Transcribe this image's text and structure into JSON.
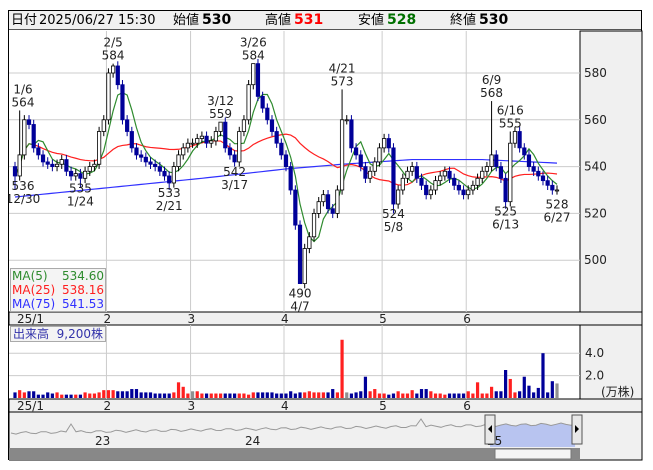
{
  "header": {
    "date_label": "日付",
    "datetime": "2025/06/27 15:30",
    "open_label": "始値",
    "open": "530",
    "high_label": "高値",
    "high": "531",
    "low_label": "安値",
    "low": "528",
    "close_label": "終値",
    "close": "530"
  },
  "colors": {
    "up_volume": "#ff2020",
    "down_volume": "#000099",
    "flat_volume": "#909090",
    "ma5": "#2e8b2e",
    "ma25": "#ff2020",
    "ma75": "#3030ff",
    "high": "#ff0000",
    "low": "#007000"
  },
  "legend": {
    "ma5_label": "MA(5)",
    "ma5": "534.60",
    "ma25_label": "MA(25)",
    "ma25": "538.16",
    "ma75_label": "MA(75)",
    "ma75": "541.53"
  },
  "volume_panel": {
    "label": "出来高",
    "value": "9,200株",
    "unit": "(万株)"
  },
  "navigator": {
    "labels": [
      "23",
      "24",
      "25"
    ]
  },
  "chart_data": {
    "type": "candlestick",
    "y_ticks": [
      580,
      560,
      540,
      520,
      500
    ],
    "ylim": [
      482,
      592
    ],
    "volume_ticks": [
      "4.0",
      "2.0"
    ],
    "volume_ylim": [
      0,
      6
    ],
    "month_labels": [
      {
        "label": "25/1",
        "index": 0
      },
      {
        "label": "2",
        "index": 20
      },
      {
        "label": "3",
        "index": 38
      },
      {
        "label": "4",
        "index": 58
      },
      {
        "label": "5",
        "index": 79
      },
      {
        "label": "6",
        "index": 97
      }
    ],
    "closes": [
      536,
      545,
      560,
      558,
      548,
      545,
      542,
      541,
      540,
      541,
      543,
      538,
      536,
      537,
      535,
      538,
      540,
      541,
      555,
      560,
      580,
      583,
      575,
      560,
      555,
      548,
      545,
      544,
      542,
      541,
      540,
      538,
      536,
      533,
      540,
      545,
      548,
      550,
      550,
      552,
      553,
      550,
      551,
      555,
      559,
      548,
      545,
      542,
      555,
      560,
      575,
      584,
      570,
      565,
      560,
      555,
      550,
      545,
      540,
      530,
      515,
      490,
      505,
      510,
      520,
      525,
      528,
      522,
      520,
      530,
      560,
      560,
      548,
      545,
      540,
      535,
      538,
      542,
      548,
      552,
      548,
      524,
      530,
      535,
      538,
      540,
      535,
      532,
      528,
      530,
      534,
      536,
      538,
      535,
      532,
      530,
      528,
      530,
      532,
      535,
      538,
      540,
      545,
      540,
      535,
      525,
      550,
      555,
      548,
      545,
      540,
      538,
      536,
      534,
      532,
      530,
      530
    ],
    "highs_override": {
      "1": 564,
      "21": 584,
      "51": 584,
      "44": 559,
      "70": 573,
      "102": 568,
      "106": 555
    },
    "lows_override": {
      "0": 530,
      "14": 531,
      "33": 530,
      "48": 540,
      "61": 490,
      "81": 520,
      "105": 522,
      "116": 528
    },
    "volumes": [
      0.5,
      0.7,
      0.5,
      0.6,
      0.6,
      0.3,
      0.3,
      0.5,
      0.4,
      0.5,
      0.3,
      0.3,
      0.3,
      0.3,
      0.3,
      0.5,
      0.4,
      0.4,
      0.5,
      0.7,
      0.7,
      0.7,
      0.6,
      0.6,
      0.6,
      0.8,
      0.8,
      0.5,
      0.5,
      0.5,
      0.4,
      0.4,
      0.4,
      0.4,
      0.5,
      1.4,
      1.0,
      0.4,
      0.6,
      0.6,
      0.4,
      0.4,
      0.4,
      0.4,
      0.4,
      0.4,
      0.4,
      0.4,
      0.4,
      0.4,
      0.3,
      0.5,
      0.5,
      0.5,
      0.5,
      0.5,
      0.4,
      0.4,
      0.4,
      0.6,
      0.4,
      0.5,
      0.5,
      0.6,
      0.5,
      0.5,
      0.5,
      0.5,
      0.8,
      0.5,
      5.2,
      0.5,
      0.4,
      0.5,
      0.6,
      1.9,
      0.6,
      0.8,
      0.4,
      0.4,
      0.3,
      0.4,
      0.6,
      0.4,
      0.4,
      0.7,
      0.4,
      0.8,
      0.8,
      0.6,
      0.4,
      0.4,
      0.3,
      0.4,
      0.4,
      0.4,
      0.4,
      0.6,
      0.4,
      1.4,
      0.4,
      0.4,
      1.0,
      0.6,
      0.6,
      2.5,
      1.7,
      0.5,
      0.6,
      1.9,
      1.1,
      0.5,
      0.9,
      4.0,
      0.5,
      1.5,
      1.3
    ],
    "ma75_points": [
      [
        0,
        527
      ],
      [
        20,
        531
      ],
      [
        40,
        535
      ],
      [
        58,
        539
      ],
      [
        70,
        541
      ],
      [
        85,
        543
      ],
      [
        100,
        543
      ],
      [
        116,
        541.5
      ]
    ],
    "annotations": [
      {
        "index": 0,
        "date": "12/30",
        "value": "536",
        "pos": "below"
      },
      {
        "index": 1,
        "date": "1/6",
        "value": "564",
        "pos": "above"
      },
      {
        "index": 14,
        "date": "1/24",
        "value": "535",
        "pos": "below"
      },
      {
        "index": 21,
        "date": "2/5",
        "value": "584",
        "pos": "above"
      },
      {
        "index": 33,
        "date": "2/21",
        "value": "533",
        "pos": "below"
      },
      {
        "index": 44,
        "date": "3/12",
        "value": "559",
        "pos": "above"
      },
      {
        "index": 47,
        "date": "3/17",
        "value": "542",
        "pos": "below"
      },
      {
        "index": 51,
        "date": "3/26",
        "value": "584",
        "pos": "above"
      },
      {
        "index": 61,
        "date": "4/7",
        "value": "490",
        "pos": "below"
      },
      {
        "index": 70,
        "date": "4/21",
        "value": "573",
        "pos": "above"
      },
      {
        "index": 81,
        "date": "5/8",
        "value": "524",
        "pos": "below"
      },
      {
        "index": 102,
        "date": "6/9",
        "value": "568",
        "pos": "above"
      },
      {
        "index": 105,
        "date": "6/13",
        "value": "525",
        "pos": "below"
      },
      {
        "index": 106,
        "date": "6/16",
        "value": "555",
        "pos": "above"
      },
      {
        "index": 116,
        "date": "6/27",
        "value": "528",
        "pos": "below"
      }
    ]
  }
}
